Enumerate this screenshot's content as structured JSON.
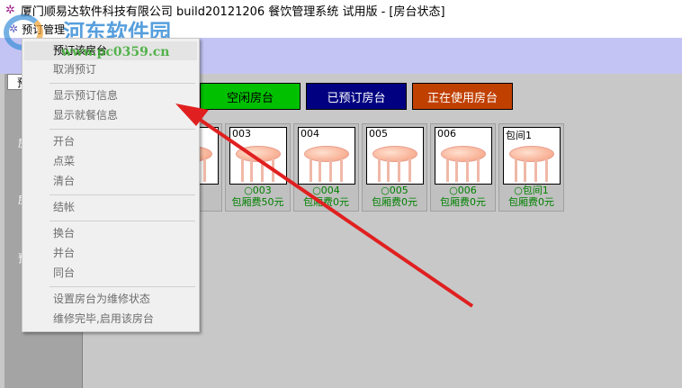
{
  "window": {
    "title": "厦门顺易达软件科技有限公司  build20121206 餐饮管理系统   试用版 - [房台状态]"
  },
  "menubar": {
    "items": [
      "预订管理"
    ]
  },
  "left_panel": {
    "tab": "预",
    "labels": [
      "房",
      "房",
      "预"
    ]
  },
  "status_buttons": [
    {
      "label": "空闲房台",
      "bg": "#00c000",
      "fg": "#000000"
    },
    {
      "label": "已预订房台",
      "bg": "#000080",
      "fg": "#ffffff"
    },
    {
      "label": "正在使用房台",
      "bg": "#c04000",
      "fg": "#ffffff"
    }
  ],
  "tables": [
    {
      "num": "",
      "line1": "",
      "line2": "元",
      "color": "#c00000"
    },
    {
      "num": "003",
      "line1": "○003",
      "line2": "包厢费50元",
      "color": "#008000"
    },
    {
      "num": "004",
      "line1": "○004",
      "line2": "包厢费0元",
      "color": "#008000"
    },
    {
      "num": "005",
      "line1": "○005",
      "line2": "包厢费0元",
      "color": "#008000"
    },
    {
      "num": "006",
      "line1": "○006",
      "line2": "包厢费0元",
      "color": "#008000"
    },
    {
      "num": "包间1",
      "line1": "○包间1",
      "line2": "包厢费0元",
      "color": "#008000"
    }
  ],
  "context_menu": {
    "items": [
      "预订该房台",
      "取消预订",
      "显示预订信息",
      "显示就餐信息",
      "开台",
      "点菜",
      "清台",
      "结帐",
      "换台",
      "并台",
      "同台",
      "设置房台为维修状态",
      "维修完毕,启用该房台"
    ]
  },
  "watermark": {
    "site": "河东软件园",
    "url": "www.pc0359.cn"
  }
}
